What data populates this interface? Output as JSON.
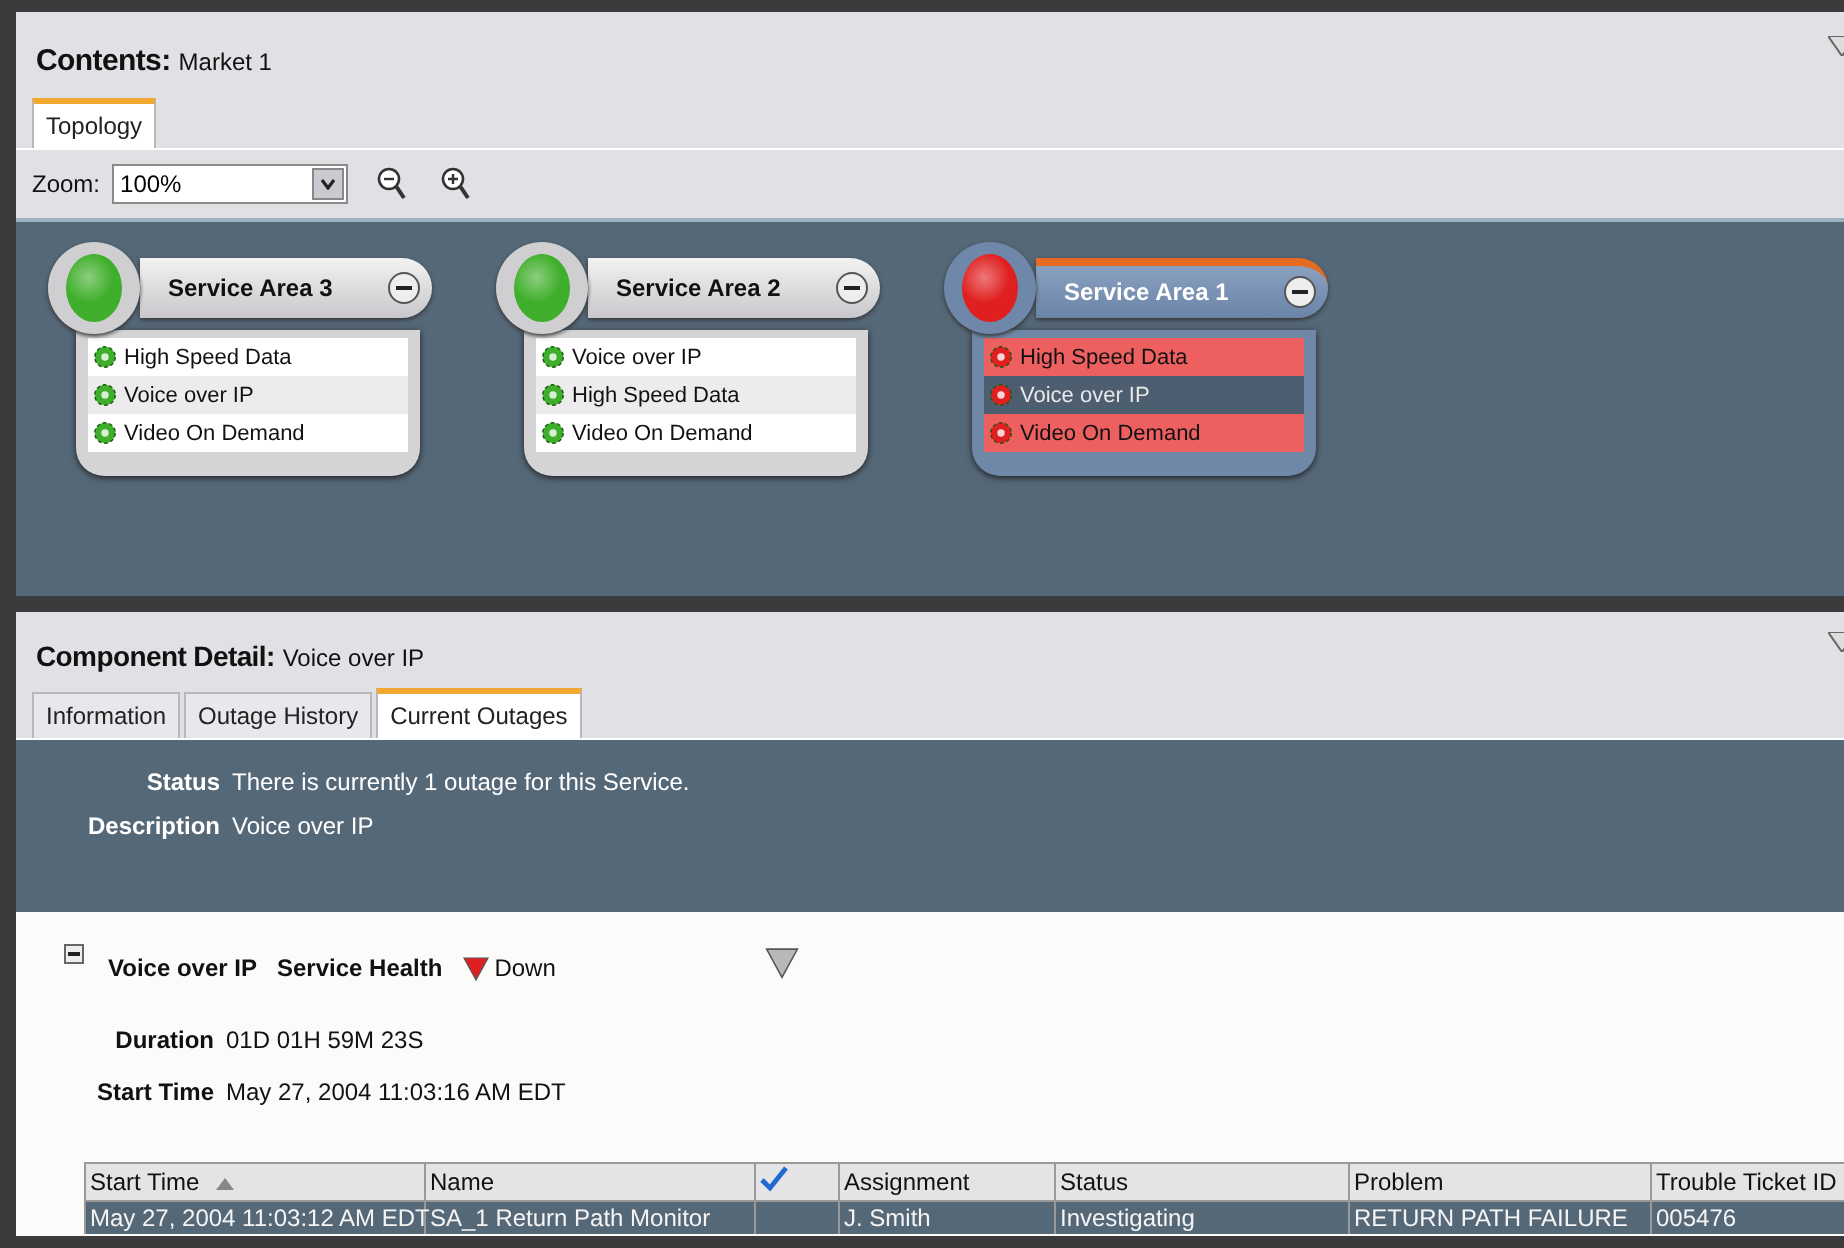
{
  "contents": {
    "label": "Contents:",
    "value": "Market 1"
  },
  "top_tabs": [
    {
      "label": "Topology",
      "selected": true
    }
  ],
  "zoom": {
    "label": "Zoom:",
    "value": "100%"
  },
  "service_areas": [
    {
      "name": "Service Area 3",
      "alarm": false,
      "selected": false,
      "services": [
        {
          "name": "High Speed Data",
          "alarm": false,
          "selected": false
        },
        {
          "name": "Voice over IP",
          "alarm": false,
          "selected": false
        },
        {
          "name": "Video On Demand",
          "alarm": false,
          "selected": false
        }
      ]
    },
    {
      "name": "Service Area 2",
      "alarm": false,
      "selected": false,
      "services": [
        {
          "name": "Voice over IP",
          "alarm": false,
          "selected": false
        },
        {
          "name": "High Speed Data",
          "alarm": false,
          "selected": false
        },
        {
          "name": "Video On Demand",
          "alarm": false,
          "selected": false
        }
      ]
    },
    {
      "name": "Service Area 1",
      "alarm": true,
      "selected": true,
      "services": [
        {
          "name": "High Speed Data",
          "alarm": true,
          "selected": false
        },
        {
          "name": "Voice over IP",
          "alarm": true,
          "selected": true
        },
        {
          "name": "Video On Demand",
          "alarm": true,
          "selected": false
        }
      ]
    }
  ],
  "detail": {
    "label": "Component Detail:",
    "value": "Voice over IP"
  },
  "detail_tabs": [
    {
      "label": "Information",
      "selected": false
    },
    {
      "label": "Outage History",
      "selected": false
    },
    {
      "label": "Current Outages",
      "selected": true
    }
  ],
  "summary": [
    {
      "label": "Status",
      "value": "There is currently 1 outage for this Service."
    },
    {
      "label": "Description",
      "value": "Voice over IP"
    }
  ],
  "outage": {
    "expanded": true,
    "name": "Voice over IP",
    "health_label": "Service Health",
    "alarm": true,
    "health_text": "Down",
    "fields": [
      {
        "label": "Duration",
        "value": "01D 01H 59M 23S"
      },
      {
        "label": "Start Time",
        "value": "May 27, 2004 11:03:16 AM EDT"
      }
    ]
  },
  "table": {
    "columns": [
      {
        "kind": "text",
        "label": "Start Time",
        "sorted": true
      },
      {
        "kind": "text",
        "label": "Name",
        "sorted": false
      },
      {
        "kind": "check"
      },
      {
        "kind": "text",
        "label": "Assignment",
        "sorted": false
      },
      {
        "kind": "text",
        "label": "Status",
        "sorted": false
      },
      {
        "kind": "text",
        "label": "Problem",
        "sorted": false
      },
      {
        "kind": "text",
        "label": "Trouble Ticket ID",
        "sorted": false
      }
    ],
    "rows": [
      {
        "selected": true,
        "cells": [
          "May 27, 2004 11:03:12 AM EDT",
          "SA_1 Return Path Monitor",
          "",
          "J. Smith",
          "Investigating",
          "RETURN PATH FAILURE",
          "005476"
        ]
      }
    ]
  }
}
